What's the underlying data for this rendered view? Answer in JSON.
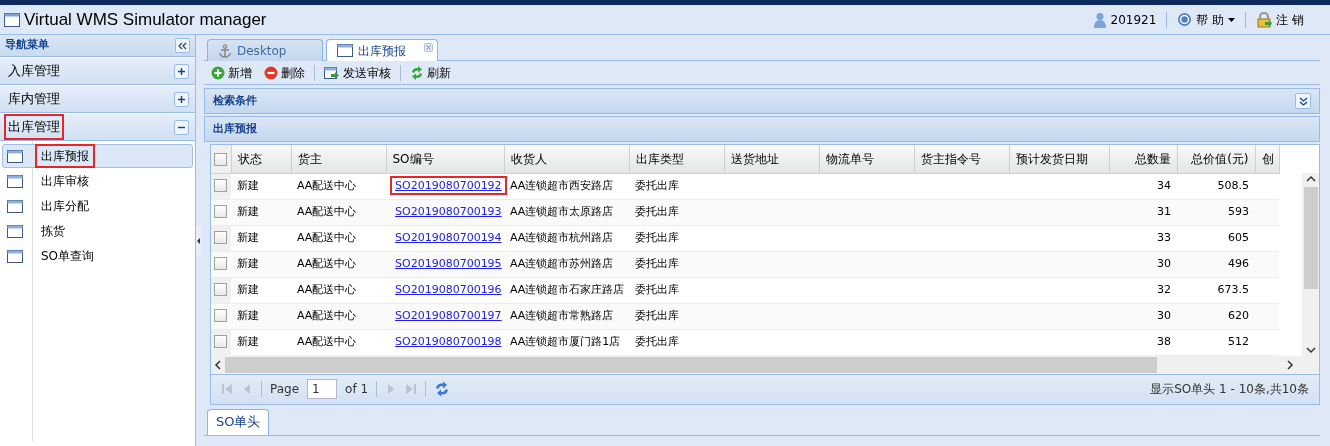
{
  "window": {
    "title": "Virtual WMS Simulator manager"
  },
  "header": {
    "user": "201921",
    "help": "帮 助",
    "logout": "注 销"
  },
  "sidebar": {
    "title": "导航菜单",
    "sections": [
      {
        "label": "入库管理",
        "expanded": false,
        "highlighted": false
      },
      {
        "label": "库内管理",
        "expanded": false,
        "highlighted": false
      },
      {
        "label": "出库管理",
        "expanded": true,
        "highlighted": true,
        "children": [
          {
            "label": "出库预报",
            "selected": true,
            "highlighted": true
          },
          {
            "label": "出库审核",
            "selected": false,
            "highlighted": false
          },
          {
            "label": "出库分配",
            "selected": false,
            "highlighted": false
          },
          {
            "label": "拣货",
            "selected": false,
            "highlighted": false
          },
          {
            "label": "SO单查询",
            "selected": false,
            "highlighted": false
          }
        ]
      }
    ]
  },
  "tabs": [
    {
      "label": "Desktop",
      "kind": "home",
      "selected": false
    },
    {
      "label": "出库预报",
      "kind": "page",
      "selected": true
    }
  ],
  "toolbar": [
    {
      "label": "新增",
      "kind": "add"
    },
    {
      "label": "删除",
      "kind": "delete"
    },
    {
      "label": "发送审核",
      "kind": "send"
    },
    {
      "label": "刷新",
      "kind": "refresh"
    }
  ],
  "search_panel": {
    "title": "检索条件",
    "collapsed": true
  },
  "grid": {
    "title": "出库预报",
    "header_checked": false,
    "columns": [
      {
        "label": "状态",
        "kind": "text"
      },
      {
        "label": "货主",
        "kind": "text"
      },
      {
        "label": "SO编号",
        "kind": "text"
      },
      {
        "label": "收货人",
        "kind": "text"
      },
      {
        "label": "出库类型",
        "kind": "text"
      },
      {
        "label": "送货地址",
        "kind": "text"
      },
      {
        "label": "物流单号",
        "kind": "text"
      },
      {
        "label": "货主指令号",
        "kind": "text"
      },
      {
        "label": "预计发货日期",
        "kind": "text"
      },
      {
        "label": "总数量",
        "kind": "number"
      },
      {
        "label": "总价值(元)",
        "kind": "number"
      },
      {
        "label": "创",
        "kind": "text"
      }
    ],
    "rows": [
      {
        "checked": false,
        "highlighted": true,
        "status": "新建",
        "owner": "AA配送中心",
        "so_number": "SO2019080700192",
        "consignee": "AA连锁超市西安路店",
        "type": "委托出库",
        "total_qty": "34",
        "total_value": "508.5"
      },
      {
        "checked": false,
        "highlighted": false,
        "status": "新建",
        "owner": "AA配送中心",
        "so_number": "SO2019080700193",
        "consignee": "AA连锁超市太原路店",
        "type": "委托出库",
        "total_qty": "31",
        "total_value": "593"
      },
      {
        "checked": false,
        "highlighted": false,
        "status": "新建",
        "owner": "AA配送中心",
        "so_number": "SO2019080700194",
        "consignee": "AA连锁超市杭州路店",
        "type": "委托出库",
        "total_qty": "33",
        "total_value": "605"
      },
      {
        "checked": false,
        "highlighted": false,
        "status": "新建",
        "owner": "AA配送中心",
        "so_number": "SO2019080700195",
        "consignee": "AA连锁超市苏州路店",
        "type": "委托出库",
        "total_qty": "30",
        "total_value": "496"
      },
      {
        "checked": false,
        "highlighted": false,
        "status": "新建",
        "owner": "AA配送中心",
        "so_number": "SO2019080700196",
        "consignee": "AA连锁超市石家庄路店",
        "type": "委托出库",
        "total_qty": "32",
        "total_value": "673.5"
      },
      {
        "checked": false,
        "highlighted": false,
        "status": "新建",
        "owner": "AA配送中心",
        "so_number": "SO2019080700197",
        "consignee": "AA连锁超市常熟路店",
        "type": "委托出库",
        "total_qty": "30",
        "total_value": "620"
      },
      {
        "checked": false,
        "highlighted": false,
        "status": "新建",
        "owner": "AA配送中心",
        "so_number": "SO2019080700198",
        "consignee": "AA连锁超市厦门路1店",
        "type": "委托出库",
        "total_qty": "38",
        "total_value": "512"
      }
    ]
  },
  "pager": {
    "page_label": "Page",
    "page": "1",
    "of": "of 1",
    "summary": "显示SO单头 1 - 10条,共10条"
  },
  "bottom_tabs": [
    {
      "label": "SO单头",
      "selected": true
    }
  ]
}
